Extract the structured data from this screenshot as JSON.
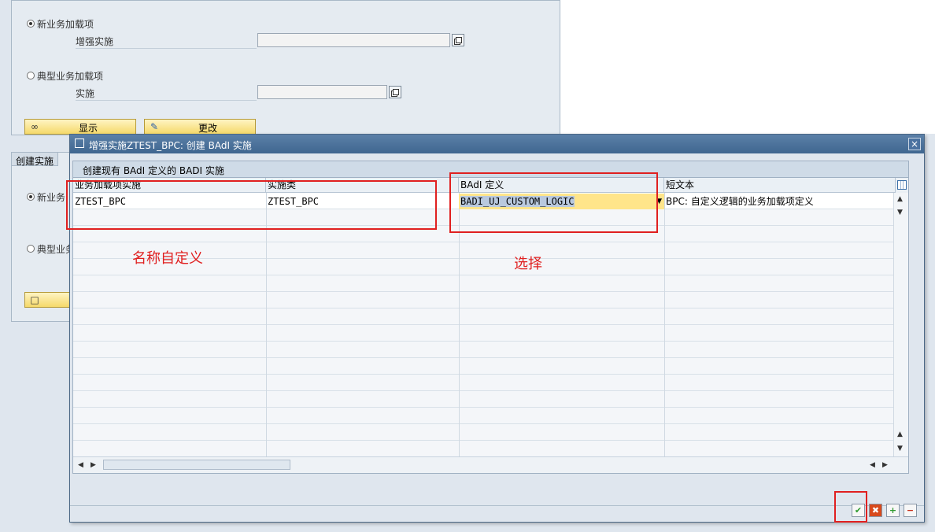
{
  "background": {
    "panel1": {
      "radio_new": "新业务加载项",
      "field_enh_label": "增强实施",
      "radio_classic": "典型业务加载项",
      "field_impl_label": "实施",
      "btn_display": "显示",
      "btn_change": "更改"
    },
    "panel2": {
      "title": "创建实施",
      "radio_new": "新业务",
      "radio_classic": "典型业务"
    }
  },
  "dialog": {
    "title": "增强实施ZTEST_BPC: 创建 BAdI 实施",
    "close": "×",
    "table_title": "创建现有 BAdI 定义的 BADI 实施",
    "columns": [
      "业务加载项实施",
      "实施类",
      "BAdI 定义",
      "短文本"
    ],
    "row": {
      "impl": "ZTEST_BPC",
      "class": "ZTEST_BPC",
      "badi_def": "BADI_UJ_CUSTOM_LOGIC",
      "short_text": "BPC: 自定义逻辑的业务加载项定义"
    },
    "footer_icons": [
      "confirm-icon",
      "cancel-icon",
      "insert-row-icon",
      "delete-row-icon"
    ]
  },
  "annotations": {
    "name_custom": "名称自定义",
    "select": "选择"
  },
  "colors": {
    "annotation": "#e02020",
    "selected_cell": "#ffe58a",
    "title_bar": "#4a6f98"
  }
}
